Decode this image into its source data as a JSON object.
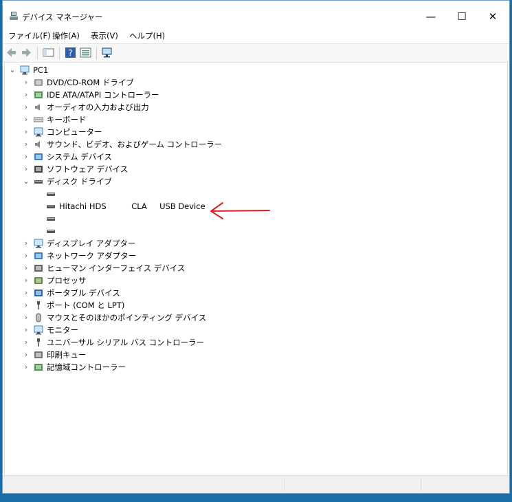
{
  "window": {
    "title": "デバイス マネージャー",
    "minimize": "—",
    "maximize": "☐",
    "close": "✕"
  },
  "menu": [
    "ファイル(F)",
    "操作(A)",
    "表示(V)",
    "ヘルプ(H)"
  ],
  "tree": {
    "root": "PC1",
    "categories": [
      {
        "label": "DVD/CD-ROM ドライブ",
        "icon": "dvd-drive-icon"
      },
      {
        "label": "IDE ATA/ATAPI コントローラー",
        "icon": "ide-controller-icon"
      },
      {
        "label": "オーディオの入力および出力",
        "icon": "speaker-icon"
      },
      {
        "label": "キーボード",
        "icon": "keyboard-icon"
      },
      {
        "label": "コンピューター",
        "icon": "computer-icon"
      },
      {
        "label": "サウンド、ビデオ、およびゲーム コントローラー",
        "icon": "sound-icon"
      },
      {
        "label": "システム デバイス",
        "icon": "system-device-icon"
      },
      {
        "label": "ソフトウェア デバイス",
        "icon": "software-device-icon"
      },
      {
        "label": "ディスク ドライブ",
        "icon": "disk-drive-icon",
        "expanded": true
      }
    ],
    "disk_children": [
      "",
      "Hitachi HDS          CLA     USB Device",
      "",
      ""
    ],
    "categories_after": [
      {
        "label": "ディスプレイ アダプター",
        "icon": "display-adapter-icon"
      },
      {
        "label": "ネットワーク アダプター",
        "icon": "network-adapter-icon"
      },
      {
        "label": "ヒューマン インターフェイス デバイス",
        "icon": "hid-icon"
      },
      {
        "label": "プロセッサ",
        "icon": "processor-icon"
      },
      {
        "label": "ポータブル デバイス",
        "icon": "portable-device-icon"
      },
      {
        "label": "ポート (COM と LPT)",
        "icon": "port-icon"
      },
      {
        "label": "マウスとそのほかのポインティング デバイス",
        "icon": "mouse-icon"
      },
      {
        "label": "モニター",
        "icon": "monitor-icon"
      },
      {
        "label": "ユニバーサル シリアル バス コントローラー",
        "icon": "usb-icon"
      },
      {
        "label": "印刷キュー",
        "icon": "printer-icon"
      },
      {
        "label": "記憶域コントローラー",
        "icon": "storage-controller-icon"
      }
    ]
  },
  "annotation": {
    "color": "#e02020"
  }
}
